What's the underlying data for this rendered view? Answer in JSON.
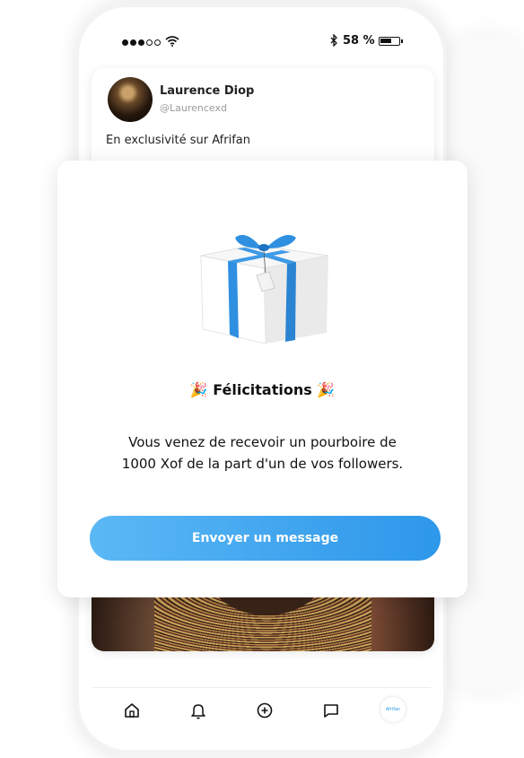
{
  "status_bar": {
    "battery_text": "58 %"
  },
  "post": {
    "author_name": "Laurence Diop",
    "author_handle": "@Laurencexd",
    "text": "En exclusivité sur Afrifan"
  },
  "modal": {
    "title": "🎉 Félicitations 🎉",
    "message": "Vous venez de recevoir un pourboire de 1000 Xof de la part d'un de vos followers.",
    "button_label": "Envoyer un message"
  },
  "nav": {
    "items": [
      "home-icon",
      "bell-icon",
      "plus-circle-icon",
      "message-icon",
      "profile-avatar"
    ],
    "avatar_text": "Afrifan"
  },
  "colors": {
    "accent": "#2d97ea",
    "accent_light": "#5bb8f5",
    "gift_ribbon": "#2f8fe0"
  }
}
